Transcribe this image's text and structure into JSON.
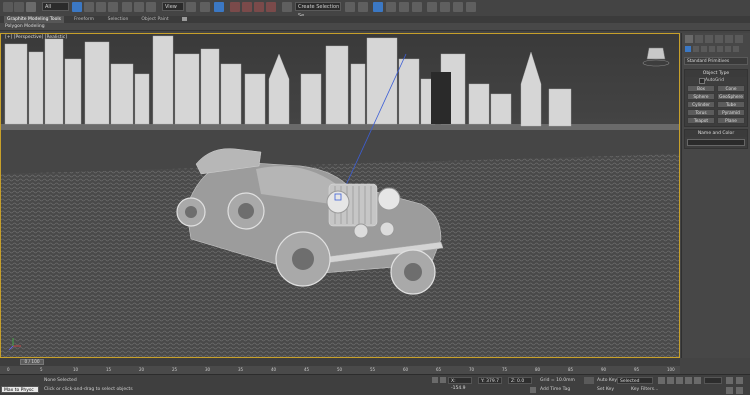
{
  "toolbar": {
    "filter_select": "All",
    "view_select": "View",
    "selection_set_placeholder": "Create Selection Se"
  },
  "ribbon": {
    "tabs": [
      "Graphite Modeling Tools",
      "Freeform",
      "Selection",
      "Object Paint"
    ],
    "active_tab": 0,
    "subtitle": "Polygon Modeling"
  },
  "viewport": {
    "label": "[+] [Perspective] [Realistic]"
  },
  "command_panel": {
    "category_select": "Standard Primitives",
    "object_type_title": "Object Type",
    "autogrid_label": "AutoGrid",
    "object_buttons": [
      "Box",
      "Cone",
      "Sphere",
      "GeoSphere",
      "Cylinder",
      "Tube",
      "Torus",
      "Pyramid",
      "Teapot",
      "Plane"
    ],
    "name_color_title": "Name and Color"
  },
  "timeline": {
    "frame_counter": "0 / 100",
    "ticks": [
      "0",
      "5",
      "10",
      "15",
      "20",
      "25",
      "30",
      "35",
      "40",
      "45",
      "50",
      "55",
      "60",
      "65",
      "70",
      "75",
      "80",
      "85",
      "90",
      "95",
      "100"
    ]
  },
  "status": {
    "maxscript": "Max to Physc",
    "selection_status": "None Selected",
    "prompt": "Click or click-and-drag to select objects",
    "x_value": "X: -154.9",
    "y_value": "Y: 379.7",
    "z_value": "Z: 0.0",
    "grid_text": "Grid = 10.0mm",
    "add_time_tag": "Add Time Tag",
    "auto_key": "Auto Key",
    "set_key": "Set Key",
    "key_mode_select": "Selected",
    "key_filters": "Key Filters..."
  },
  "colors": {
    "accent_viewport_border": "#c7a02a",
    "active_tab": "#575757",
    "ui_background": "#444444"
  }
}
